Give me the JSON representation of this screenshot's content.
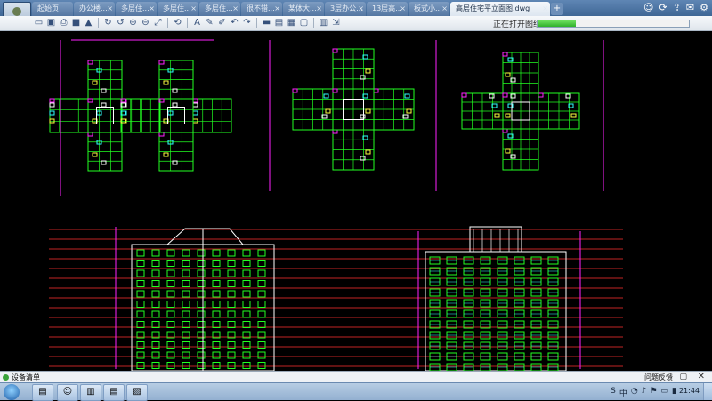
{
  "tabs": [
    {
      "label": "起始页"
    },
    {
      "label": "办公楼..."
    },
    {
      "label": "多层住..."
    },
    {
      "label": "多层住..."
    },
    {
      "label": "多层住..."
    },
    {
      "label": "很不错..."
    },
    {
      "label": "某体大..."
    },
    {
      "label": "3层办公..."
    },
    {
      "label": "13层高..."
    },
    {
      "label": "板式小..."
    },
    {
      "label": "高层住宅平立面图.dwg",
      "active": true
    }
  ],
  "tab_add_label": "+",
  "window_icons": [
    "person-icon",
    "refresh-icon",
    "share-icon",
    "mail-icon",
    "settings-icon"
  ],
  "window_icon_glyphs": [
    "☺",
    "⟳",
    "⇪",
    "✉",
    "⚙"
  ],
  "toolbar_icons": [
    "open-icon",
    "save-icon",
    "print-icon",
    "pdf-icon",
    "lock-icon",
    "refresh-icon",
    "rotate-icon",
    "zoom-in-icon",
    "zoom-out-icon",
    "fit-icon",
    "undo-icon",
    "text-icon",
    "pen-icon",
    "brush-icon",
    "undo-arrow-icon",
    "redo-arrow-icon",
    "measure-icon",
    "layers-icon",
    "image-icon",
    "page-icon",
    "layout-icon",
    "export-icon"
  ],
  "toolbar_glyphs": [
    "▭",
    "▣",
    "⎙",
    "■",
    "▲",
    "↻",
    "↺",
    "⊕",
    "⊖",
    "⤢",
    "⟲",
    "A",
    "✎",
    "✐",
    "↶",
    "↷",
    "▬",
    "▤",
    "▦",
    "▢",
    "▥",
    "⇲"
  ],
  "status": {
    "text": "正在打开图纸",
    "progress": 0.25
  },
  "panel": {
    "label": "设备清单",
    "feedback": "问题反馈",
    "chat_glyph": "▢",
    "close_glyph": "✕"
  },
  "taskbar": {
    "items": [
      "folder-icon",
      "avatar-icon",
      "books-icon",
      "folder2-icon",
      "cad-app-icon"
    ],
    "item_glyphs": [
      "▤",
      "☺",
      "▥",
      "▤",
      "▨"
    ],
    "tray": [
      "S",
      "中",
      "◔",
      "♪",
      "⚑",
      "▭",
      "▮"
    ],
    "clock": "21:44"
  },
  "colors": {
    "canvas": "#000000",
    "line_green": "#22ff22",
    "line_magenta": "#ff22ff",
    "line_red": "#ff3030",
    "line_white": "#ffffff",
    "line_yellow": "#ffff40",
    "line_cyan": "#30ffff"
  }
}
